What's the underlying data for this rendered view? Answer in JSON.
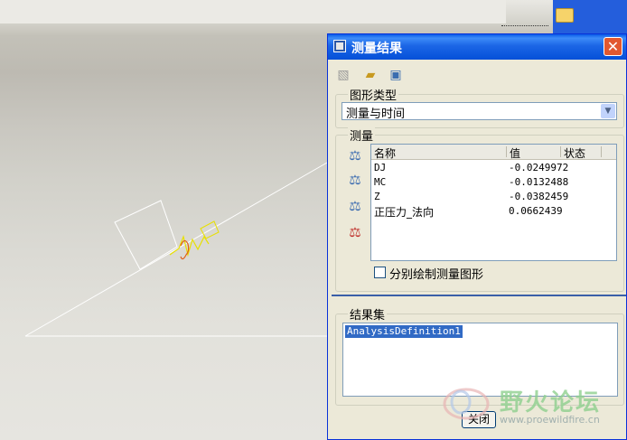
{
  "window": {
    "title": "测量结果",
    "close_glyph": "✕"
  },
  "toolbar": {
    "icons": [
      "measure-icon",
      "open-folder-icon",
      "save-icon"
    ]
  },
  "graph_type": {
    "label": "图形类型",
    "selected": "测量与时间"
  },
  "measures": {
    "label": "测量",
    "columns": [
      "名称",
      "值",
      "状态"
    ],
    "rows": [
      {
        "name": "DJ",
        "value": "-0.0249972",
        "status": ""
      },
      {
        "name": "MC",
        "value": "-0.0132488",
        "status": ""
      },
      {
        "name": "Z",
        "value": "-0.0382459",
        "status": ""
      },
      {
        "name": "正压力_法向",
        "value": "0.0662439",
        "status": ""
      }
    ],
    "side_icons": [
      "scale-icon",
      "scale-edit-icon",
      "scale-copy-icon",
      "scale-delete-icon"
    ],
    "checkbox_label": "分别绘制测量图形",
    "checkbox_checked": false
  },
  "result_set": {
    "label": "结果集",
    "items": [
      "AnalysisDefinition1"
    ]
  },
  "buttons": {
    "close": "关闭"
  },
  "watermark": {
    "text": "野火论坛",
    "url": "www.proewildfire.cn"
  },
  "colors": {
    "title_bar": "#0a5be8",
    "selection": "#316ac5",
    "dialog_bg": "#ece9d8"
  }
}
